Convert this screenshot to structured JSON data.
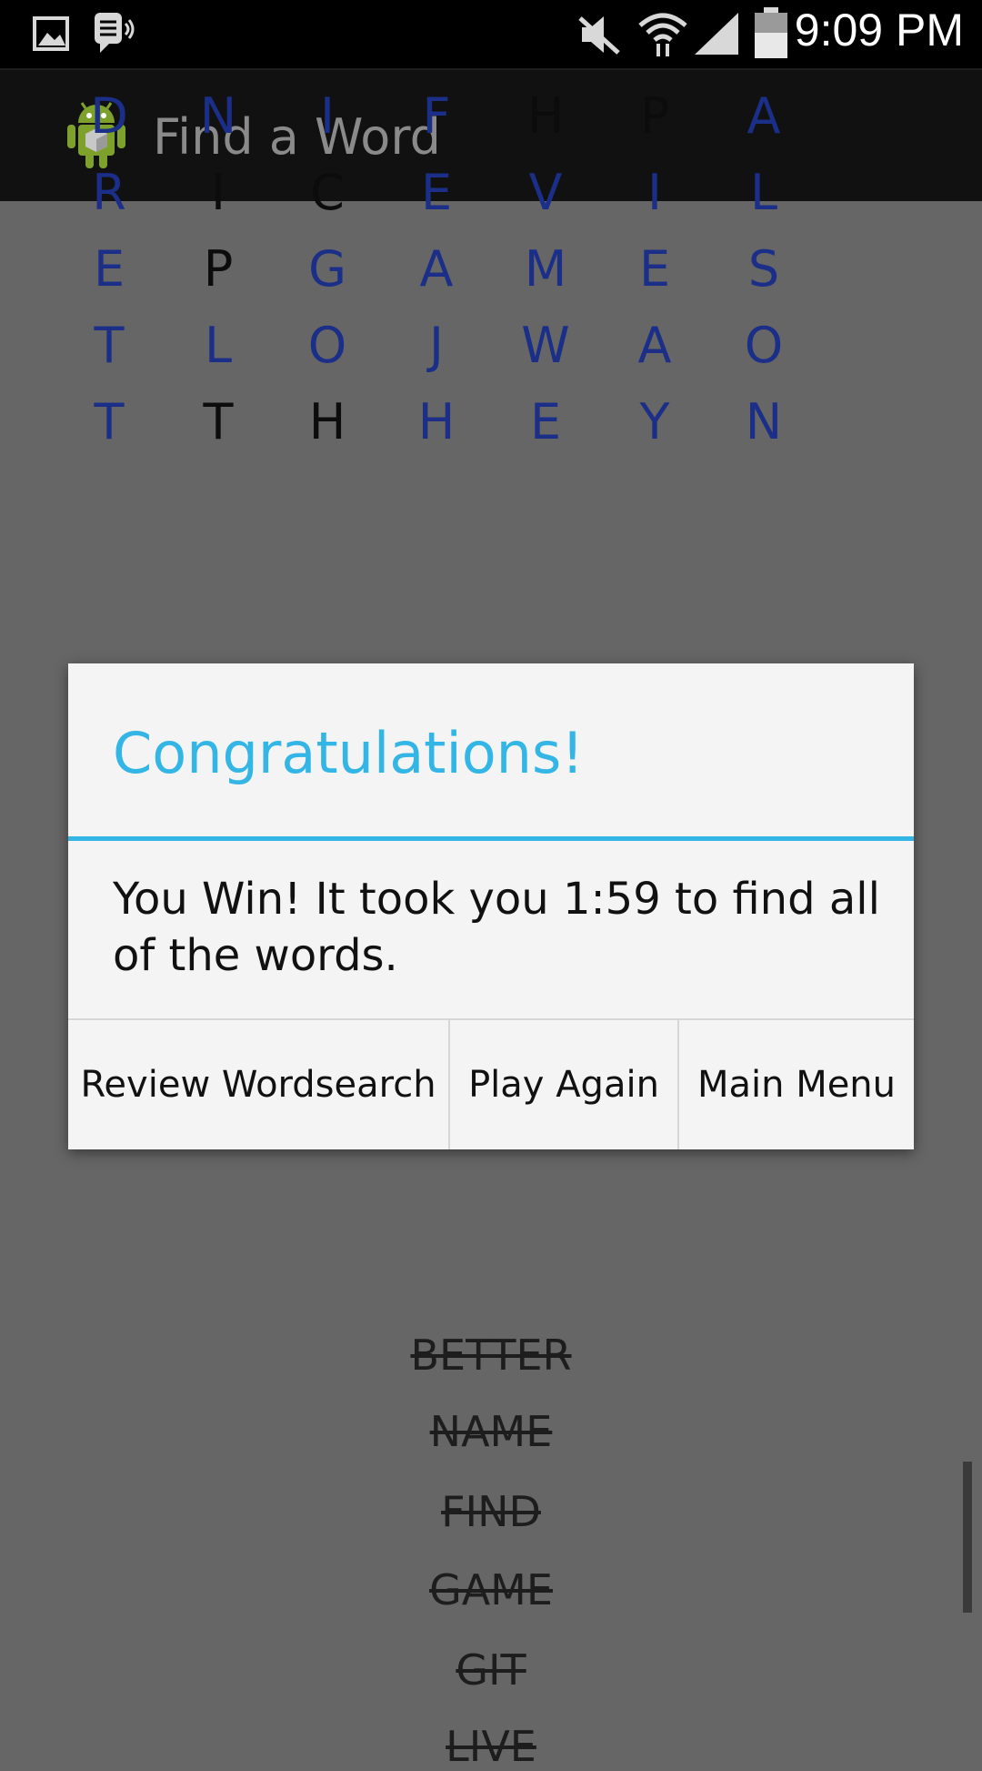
{
  "status_bar": {
    "time": "9:09 PM",
    "icons": [
      "gallery-icon",
      "voice-mail-icon",
      "mute-icon",
      "wifi-icon",
      "signal-icon",
      "battery-icon"
    ]
  },
  "action_bar": {
    "title": "Find a Word",
    "logo_icon": "android-icon"
  },
  "grid": {
    "rows": [
      [
        "D",
        "N",
        "I",
        "F",
        "H",
        "P",
        "A"
      ],
      [
        "R",
        "I",
        "C",
        "E",
        "V",
        "I",
        "L"
      ],
      [
        "E",
        "P",
        "G",
        "A",
        "M",
        "E",
        "S"
      ],
      [
        "T",
        "L",
        "O",
        "J",
        "W",
        "A",
        "O"
      ],
      [
        "T",
        "T",
        "H",
        "H",
        "E",
        "Y",
        "N"
      ]
    ],
    "found": [
      [
        true,
        true,
        true,
        true,
        false,
        false,
        true
      ],
      [
        true,
        false,
        false,
        true,
        true,
        true,
        true
      ],
      [
        true,
        false,
        true,
        true,
        true,
        true,
        true
      ],
      [
        true,
        true,
        true,
        true,
        true,
        true,
        true
      ],
      [
        true,
        false,
        false,
        true,
        true,
        true,
        true
      ]
    ],
    "found_color": "#1b2e88",
    "plain_color": "#0c0c0c"
  },
  "word_list": {
    "words": [
      "BETTER",
      "NAME",
      "FIND",
      "GAME",
      "GIT",
      "LIVE"
    ]
  },
  "dialog": {
    "title": "Congratulations!",
    "message": "You Win! It took you 1:59 to find all of the words.",
    "buttons": {
      "review": "Review Wordsearch",
      "play_again": "Play Again",
      "main_menu": "Main Menu"
    },
    "accent_color": "#33b5e5"
  }
}
